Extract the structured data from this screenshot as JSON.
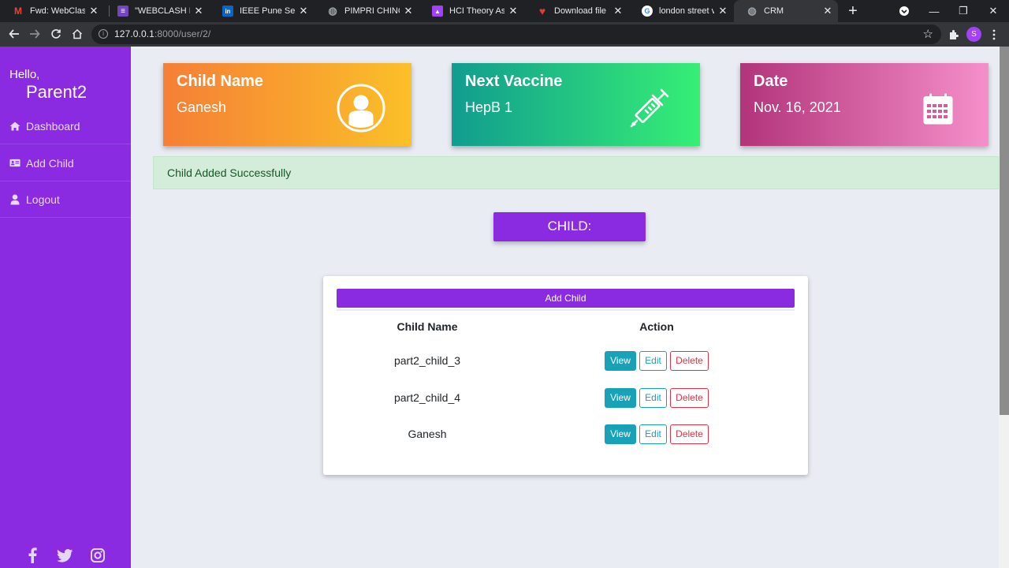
{
  "browser": {
    "tabs": [
      {
        "title": "Fwd: WebClash: Fi",
        "icon": "gmail-icon",
        "color": "#ea4335",
        "glyph": "M"
      },
      {
        "title": "\"WEBCLASH REGI",
        "icon": "forms-icon",
        "color": "#7248b9",
        "glyph": "≡"
      },
      {
        "title": "IEEE Pune Section",
        "icon": "linkedin-icon",
        "color": "#0a66c2",
        "glyph": "in"
      },
      {
        "title": "PIMPRI CHINCHW",
        "icon": "globe-icon",
        "color": "#9aa0a6",
        "glyph": "◍"
      },
      {
        "title": "HCI Theory Assign",
        "icon": "classroom-icon",
        "color": "#a142f4",
        "glyph": "▲"
      },
      {
        "title": "Download file | iL",
        "icon": "heart-icon",
        "color": "#e53935",
        "glyph": "♥"
      },
      {
        "title": "london street view",
        "icon": "google-icon",
        "color": "#ffffff",
        "glyph": "G"
      },
      {
        "title": "CRM",
        "icon": "globe-icon",
        "color": "#9aa0a6",
        "glyph": "◍"
      }
    ],
    "url_host": "127.0.0.1",
    "url_rest": ":8000/user/2/",
    "profile_initial": "S"
  },
  "sidebar": {
    "greeting": "Hello,",
    "username": "Parent2",
    "items": [
      {
        "label": "Dashboard",
        "icon": "home-icon"
      },
      {
        "label": "Add Child",
        "icon": "id-card-icon"
      },
      {
        "label": "Logout",
        "icon": "user-icon"
      }
    ],
    "social": [
      "facebook-icon",
      "twitter-icon",
      "instagram-icon"
    ]
  },
  "cards": {
    "child": {
      "title": "Child Name",
      "value": "Ganesh",
      "icon": "user-circle-icon"
    },
    "vaccine": {
      "title": "Next Vaccine",
      "value": "HepB 1",
      "icon": "syringe-icon"
    },
    "date": {
      "title": "Date",
      "value": "Nov. 16, 2021",
      "icon": "calendar-icon"
    }
  },
  "alert": {
    "message": "Child Added Successfully"
  },
  "section": {
    "heading": "CHILD:"
  },
  "table": {
    "add_label": "Add Child",
    "headers": {
      "name": "Child Name",
      "action": "Action"
    },
    "rows": [
      {
        "name": "part2_child_3"
      },
      {
        "name": "part2_child_4"
      },
      {
        "name": "Ganesh"
      }
    ],
    "actions": {
      "view": "View",
      "edit": "Edit",
      "delete": "Delete"
    }
  },
  "colors": {
    "brand": "#8a2be2",
    "info": "#17a2b8",
    "danger": "#dc3545",
    "success_bg": "#d4edda"
  }
}
